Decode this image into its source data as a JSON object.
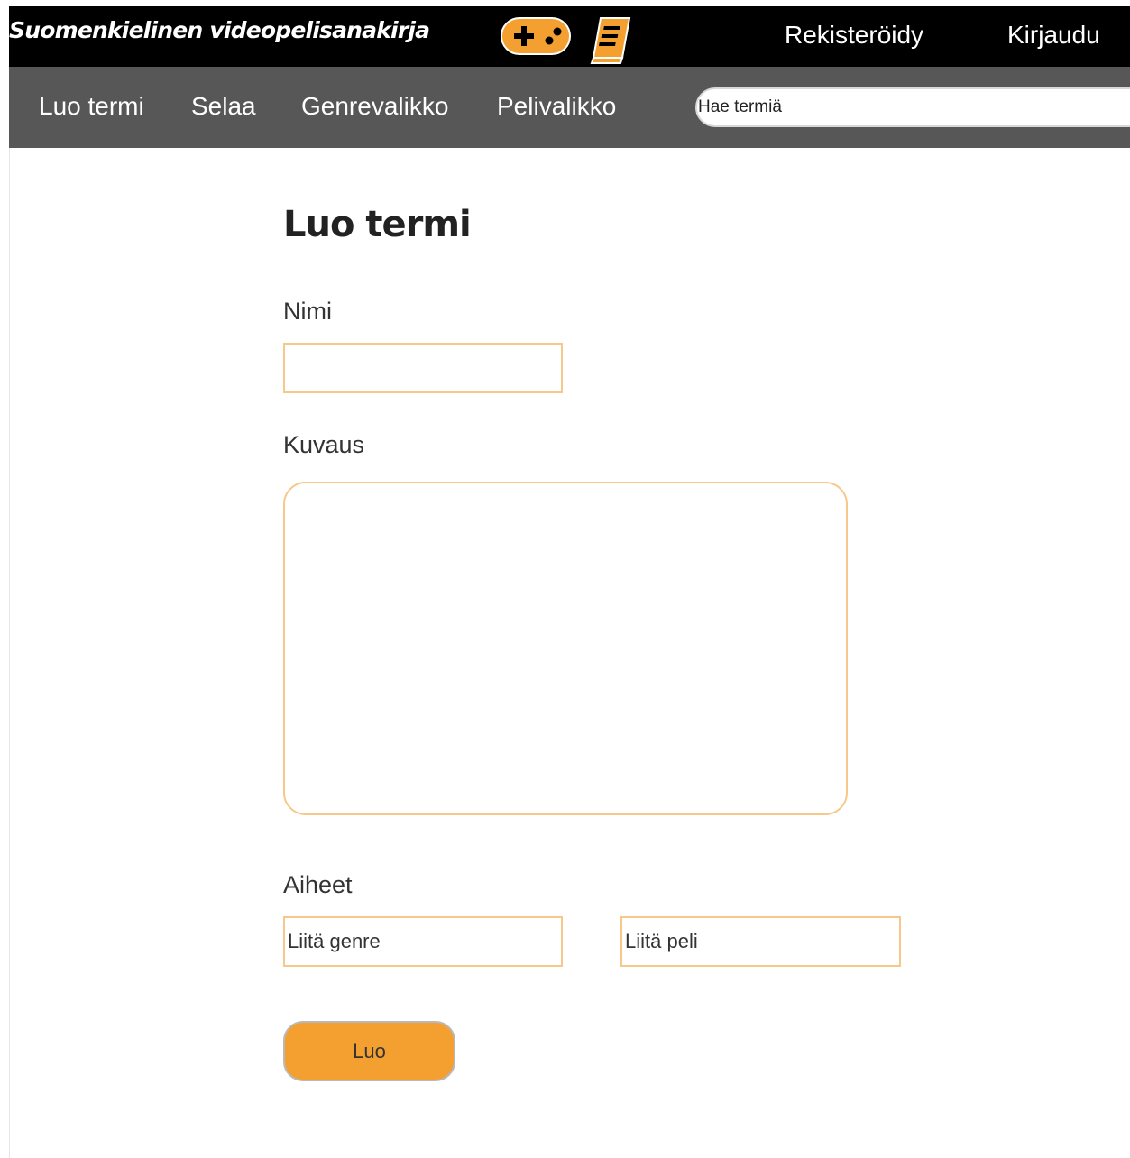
{
  "header": {
    "site_title": "Suomenkielinen videopelisanakirja",
    "register_label": "Rekisteröidy",
    "login_label": "Kirjaudu"
  },
  "nav": {
    "items": [
      {
        "label": "Luo termi"
      },
      {
        "label": "Selaa"
      },
      {
        "label": "Genrevalikko"
      },
      {
        "label": "Pelivalikko"
      }
    ],
    "search": {
      "placeholder": "Hae termiä",
      "value": ""
    }
  },
  "form": {
    "title": "Luo termi",
    "name_label": "Nimi",
    "name_value": "",
    "description_label": "Kuvaus",
    "description_value": "",
    "topics_label": "Aiheet",
    "genre_placeholder": "Liitä genre",
    "game_placeholder": "Liitä peli",
    "submit_label": "Luo"
  },
  "colors": {
    "topbar": "#000000",
    "navbar": "#575757",
    "accent": "#f4a030",
    "field_border": "#f7c88a"
  },
  "icons": {
    "gamepad": "gamepad-icon",
    "book": "book-icon"
  }
}
